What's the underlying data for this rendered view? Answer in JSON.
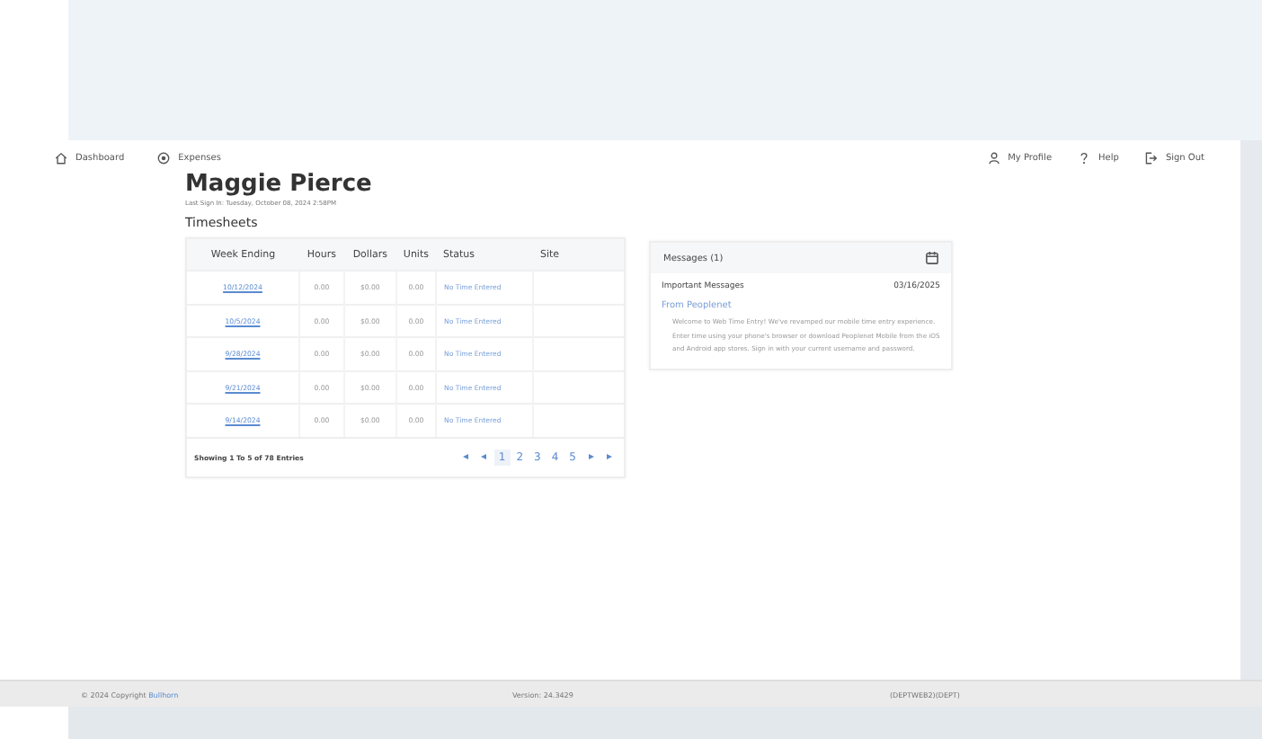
{
  "nav": {
    "left": [
      {
        "label": "Dashboard"
      },
      {
        "label": "Expenses"
      }
    ],
    "right": [
      {
        "label": "My Profile"
      },
      {
        "label": "Help"
      },
      {
        "label": "Sign Out"
      }
    ]
  },
  "user": {
    "name": "Maggie Pierce",
    "last_sign_in": "Last Sign In: Tuesday, October 08, 2024 2:58PM"
  },
  "timesheets": {
    "title": "Timesheets",
    "columns": [
      "Week Ending",
      "Hours",
      "Dollars",
      "Units",
      "Status",
      "Site"
    ],
    "rows": [
      {
        "week_ending": "10/12/2024",
        "hours": "0.00",
        "dollars": "$0.00",
        "units": "0.00",
        "status": "No Time Entered"
      },
      {
        "week_ending": "10/5/2024",
        "hours": "0.00",
        "dollars": "$0.00",
        "units": "0.00",
        "status": "No Time Entered"
      },
      {
        "week_ending": "9/28/2024",
        "hours": "0.00",
        "dollars": "$0.00",
        "units": "0.00",
        "status": "No Time Entered"
      },
      {
        "week_ending": "9/21/2024",
        "hours": "0.00",
        "dollars": "$0.00",
        "units": "0.00",
        "status": "No Time Entered"
      },
      {
        "week_ending": "9/14/2024",
        "hours": "0.00",
        "dollars": "$0.00",
        "units": "0.00",
        "status": "No Time Entered"
      }
    ],
    "showing": "Showing 1 To 5 of 78 Entries",
    "pages": [
      {
        "label": "1",
        "selected": true
      },
      {
        "label": "2",
        "selected": false
      },
      {
        "label": "3",
        "selected": false
      },
      {
        "label": "4",
        "selected": false
      },
      {
        "label": "5",
        "selected": false
      }
    ]
  },
  "messages": {
    "title": "Messages (1)",
    "items": [
      {
        "title": "Important Messages",
        "date": "03/16/2025",
        "from": "From Peoplenet",
        "body": "Welcome to Web Time Entry! We've revamped our mobile time entry experience. Enter time using your phone's browser or download Peoplenet Mobile from the iOS and Android app stores. Sign in with your current username and password."
      }
    ]
  },
  "footer": {
    "copyright": "© 2024 Copyright",
    "company": "Bullhorn",
    "version": "Version: 24.3429",
    "server": "(DEPTWEB2)(DEPT)"
  }
}
